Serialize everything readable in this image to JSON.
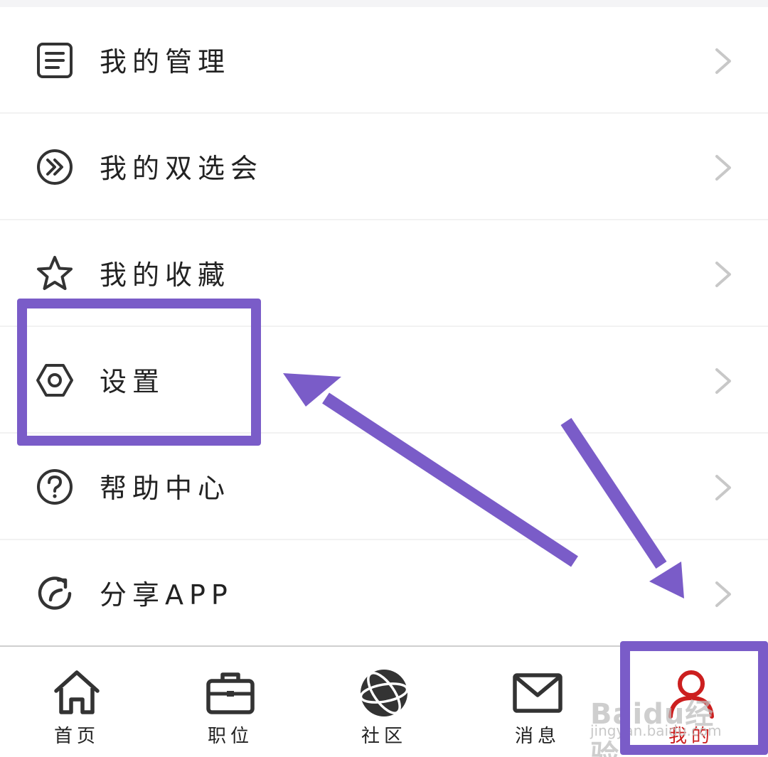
{
  "menu": {
    "items": [
      {
        "label": "我的管理",
        "icon": "list-icon"
      },
      {
        "label": "我的双选会",
        "icon": "double-chevron-circle-icon"
      },
      {
        "label": "我的收藏",
        "icon": "star-icon"
      },
      {
        "label": "设置",
        "icon": "hexagon-nut-icon"
      },
      {
        "label": "帮助中心",
        "icon": "question-circle-icon"
      },
      {
        "label": "分享APP",
        "icon": "share-refresh-icon"
      }
    ]
  },
  "tabbar": {
    "tabs": [
      {
        "label": "首页",
        "icon": "home-icon",
        "active": false
      },
      {
        "label": "职位",
        "icon": "briefcase-icon",
        "active": false
      },
      {
        "label": "社区",
        "icon": "globe-icon",
        "active": false
      },
      {
        "label": "消息",
        "icon": "mail-icon",
        "active": false
      },
      {
        "label": "我的",
        "icon": "user-icon",
        "active": true
      }
    ]
  },
  "watermark": {
    "brand": "Baidu经验",
    "url": "jingyan.baidu.com"
  },
  "colors": {
    "annotation": "#7a5cc8",
    "active_tab": "#cc1f1f",
    "icon": "#333333",
    "chevron": "#c8c8c8"
  }
}
